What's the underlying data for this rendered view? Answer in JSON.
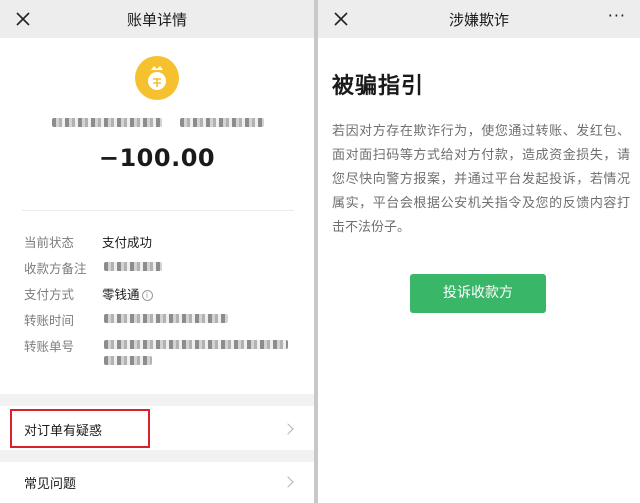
{
  "bill_screen": {
    "title": "账单详情",
    "amount": "−100.00",
    "rows": [
      {
        "label": "当前状态",
        "value": "支付成功"
      },
      {
        "label": "收款方备注",
        "value": ""
      },
      {
        "label": "支付方式",
        "value": "零钱通"
      },
      {
        "label": "转账时间",
        "value": ""
      },
      {
        "label": "转账单号",
        "value": ""
      }
    ],
    "info_icon_glyph": "i",
    "list": [
      {
        "label": "对订单有疑惑"
      },
      {
        "label": "常见问题"
      }
    ],
    "colors": {
      "coin": "#f6c12f",
      "highlight": "#d8232a"
    }
  },
  "fraud_screen": {
    "title": "涉嫌欺诈",
    "more": "···",
    "heading": "被骗指引",
    "paragraph": "若因对方存在欺诈行为，使您通过转账、发红包、面对面扫码等方式给对方付款，造成资金损失，请您尽快向警方报案，并通过平台发起投诉，若情况属实，平台会根据公安机关指令及您的反馈内容打击不法份子。",
    "button_label": "投诉收款方",
    "colors": {
      "button": "#3ab669"
    }
  }
}
